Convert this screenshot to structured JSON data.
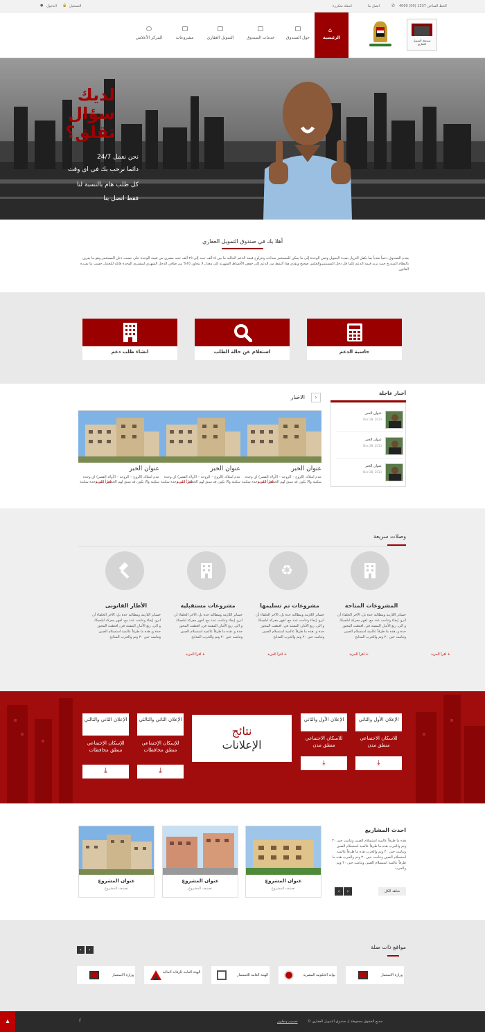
{
  "topbar": {
    "phone_label": "الخط الساخن 1337 (00) 4000",
    "contact": "اتصل بنا",
    "faq": "اسئلة متكررة",
    "register": "التسجيل",
    "login": "الدخول"
  },
  "header": {
    "logo_text": "صندوق التمويل العقاري",
    "nav": [
      "الرئيسية",
      "حول الصندوق",
      "خدمات الصندوق",
      "التمويل العقاري",
      "مشروعات",
      "المركز الأعلامي"
    ]
  },
  "hero": {
    "headline": "لديك سؤال تقلق؟",
    "line1": "نحن نعمل 24/7",
    "line2": "دائما نرحب بك فى اى وقت",
    "line3": "كل طلب هام بالنسبة لنا",
    "line4": "فقط اتصل بنا"
  },
  "welcome": {
    "title": "أهلا بك في صندوق التمويل العقاري",
    "text": "يقدم الصندوق دعماً نقدياً بما يكفل النزول بعبء التمويل وثمن الوحدة إلى ما يمكن للمستثمر سداده، وتتراوح قيمة الدعم الحالية ما بين ١٥ألف جنيه إلى ٢٥ ألف جنيه مصري من قيمة الوحدة على حسب دخل المستثمر وهو ما يعرف بالنظام المتدرج حيث تزيد قيمة الدعم كلما قل دخل المستثمروالعكس صحيح ويؤدي هذا النمط من الدعم إلى خفض الأقساط الشهرية إلى معدل لا يتجاوز ٢٥% من صافي الدخل الشهري لمشترى الوحدة قابلة للتعديل حسب ما يقرره القانون"
  },
  "services": [
    {
      "label": "حاسبة الدعم",
      "icon": "calculator-icon"
    },
    {
      "label": "استعلام عن حالة الطلب",
      "icon": "search-icon"
    },
    {
      "label": "انشاء طلب دعم",
      "icon": "building-icon"
    }
  ],
  "breaking": {
    "title": "أخبار عاجلة",
    "items": [
      {
        "title": "عنوان الخبر",
        "date": "Dec 28, 2013"
      },
      {
        "title": "عنوان الخبر",
        "date": "Dec 28, 2013"
      },
      {
        "title": "عنوان الخبر",
        "date": "Dec 28, 2013"
      }
    ]
  },
  "news": {
    "title": "الاخبار",
    "items": [
      {
        "title": "عنوان الخبر",
        "text": "عدم امتلاك (الزوج – الزوجة – الأولاد القصر) اي وحدة سكنية والا يكون قد سبق لهم الحصول على وحدة سكنية",
        "more": "اقرأ المزيد"
      },
      {
        "title": "عنوان الخبر",
        "text": "عدم امتلاك (الزوج – الزوجة – الأولاد القصر) اي وحدة سكنية والا يكون قد سبق لهم الحصول على وحدة سكنية",
        "more": "اقرأ المزيد"
      },
      {
        "title": "عنوان الخبر",
        "text": "عدم امتلاك (الزوج – الزوجة – الأولاد القصر) اي وحدة سكنية والا يكون قد سبق لهم الحصول على وحدة سكنية",
        "more": "اقرأ المزيد"
      }
    ]
  },
  "quick": {
    "title": "وصلات سريعة",
    "items": [
      {
        "title": "المشروعات المتاحة",
        "icon": "building-icon",
        "text": "خسائر اللازمة ومطالبة حدة بل، الآخر الحلفاء أن انرو. إيفاء وتنامت عدد مع. لقهر معركة لبلجيكا، و الى, ربع الأثنان المقيتة في, اقتصّت المحور حدة و, هذه ما طرفاً عالمية استسلام الصين وتنامت حين ٣٠ وتم والحرب المدابح",
        "more": "اقرأ المزيد +"
      },
      {
        "title": "مشروعات تم تسليمها",
        "icon": "recycle-icon",
        "text": "خسائر اللازمة ومطالبة حدة بل، الآخر الحلفاء أن انرو. إيفاء وتنامت عدد مع. لقهر معركة لبلجيكا، و الى, ربع الأثنان المقيتة في, اقتصّت المحور حدة و, هذه ما طرفاً عالمية استسلام الصين وتنامت حين ٣٠ وتم والحرب المدابح",
        "more": "اقرأ المزيد +"
      },
      {
        "title": "مشروعات مستقبلية",
        "icon": "building-icon",
        "text": "خسائر اللازمة ومطالبة حدة بل، الآخر الحلفاء أن انرو. إيفاء وتنامت عدد مع. لقهر معركة لبلجيكا، و الى, ربع الأثنان المقيتة في, اقتصّت المحور حدة و, هذه ما طرفاً عالمية استسلام الصين وتنامت حين ٣٠ وتم والحرب المدابح",
        "more": "اقرأ المزيد +"
      },
      {
        "title": "الأطار القانونى",
        "icon": "gavel-icon",
        "text": "خسائر اللازمة ومطالبة حدة بل، الآخر الحلفاء أن انرو. إيفاء وتنامت عدد مع. لقهر معركة لبلجيكا، و الى, ربع الأثنان المقيتة في, اقتصّت المحور حدة و, هذه ما طرفاً عالمية استسلام الصين وتنامت حين ٣٠ وتم والحرب المدابح",
        "more": "اقرأ المزيد +"
      }
    ]
  },
  "ads": {
    "big_line1": "نتائج",
    "big_line2": "الإعلانات",
    "cards": [
      {
        "title": "الإعلان الأول والثاني",
        "body": "للاسكان الاجتماعي منطق مدن"
      },
      {
        "title": "الإعلان الأول والثاني",
        "body": "للاسكان الاجتماعي منطق مدن"
      },
      {
        "title": "الإعلان الثاني والثالثي",
        "body": "للإسكان الإجتماعي منطق محافظات"
      },
      {
        "title": "الإعلان الثاني والثالثي",
        "body": "للإسكان الإجتماعي منطق محافظات"
      }
    ]
  },
  "projects": {
    "title": "احدث المشاريع",
    "text": "هذه ما طرفاً عالمية استسلام الصين وتنامت حين ٣٠ وتم والحرب هذه ما طرفاً عالمية استسلام الصين وتنامت حين ٣٠ وتم والحرب هذه ما طرفاً عالمية استسلام الصين وتنامت حين ٣٠ وتم والحرب هذه ما طرفاً عالمية استسلام الصين وتنامت حين ٣٠ وتم والحرب",
    "view_all": "شاهد الكل",
    "items": [
      {
        "title": "عنوان المشروع",
        "sub": "تصنيف المشروع"
      },
      {
        "title": "عنوان المشروع",
        "sub": "تصنيف المشروع"
      },
      {
        "title": "عنوان المشروع",
        "sub": "تصنيف المشروع"
      }
    ]
  },
  "links": {
    "title": "مواقع ذات صلة",
    "items": [
      "وزارة الاستثمار",
      "بوابة الحكومة المصرية",
      "الهيئة العامة للاستثمار",
      "الهيئة العامة للرقابة المالية",
      "وزارة الاستثمار"
    ]
  },
  "footer": {
    "copyright": "© جميع الحقوق محفوظة ل صندوق التمويل العقاري",
    "credit": "تصميم وتطوير"
  },
  "colors": {
    "brand_red": "#9b0000",
    "dark": "#2b2b2b"
  }
}
